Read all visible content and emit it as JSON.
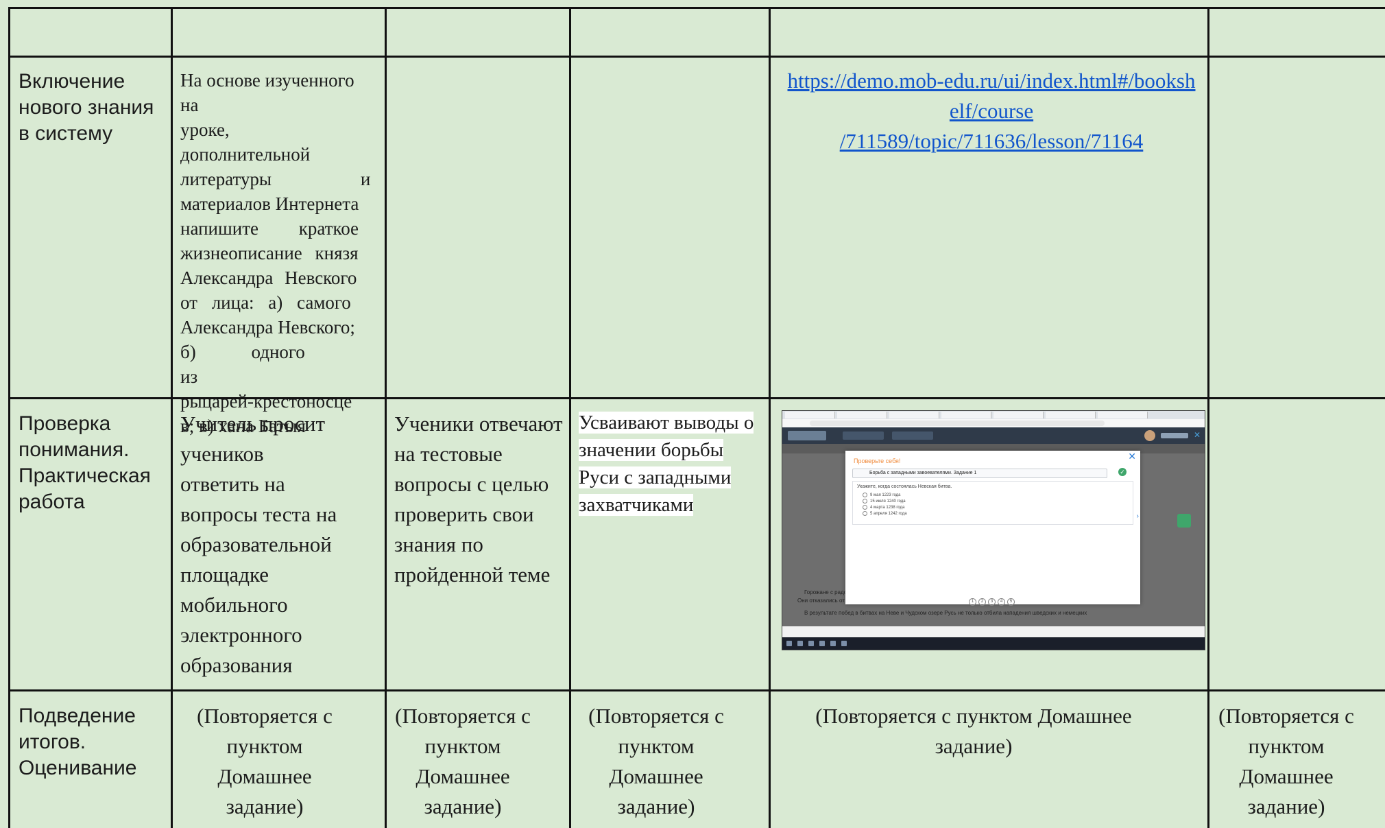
{
  "rows": {
    "inclusion": {
      "stage": "Включение нового знания в систему",
      "teacher_lines": [
        "На основе изученного",
        "на уроке,",
        "дополнительной",
        "литературы и",
        "материалов Интернета",
        "напишите краткое",
        "жизнеописание князя",
        "Александра Невского",
        "от лица: а) самого",
        "Александра Невского;",
        "б) одного из",
        "рыцарей-крестоносце",
        "в; в) хана Батыя"
      ],
      "link_lines": [
        "https://demo.mob-edu.ru/ui/index.html#/booksh",
        "elf/course",
        "/711589/topic/711636/lesson/71164"
      ]
    },
    "check": {
      "stage": "Проверка понимания. Практическая работа",
      "teacher": "Учитель просит учеников ответить на вопросы теста на образовательной площадке мобильного электронного образования",
      "students": "Ученики отвечают на тестовые вопросы с целью проверить свои знания по пройденной теме",
      "result_lines": [
        "Усваивают выводы о",
        "значении борьбы",
        "Руси с западными",
        "захватчиками"
      ]
    },
    "summary": {
      "stage": "Подведение итогов. Оценивание",
      "repeat_text": "(Повторяется с пунктом Домашнее задание)"
    }
  },
  "screenshot": {
    "dialog_title": "Проверьте себя!",
    "question_header": "Борьба с западными завоевателями. Задание 1",
    "question": "Укажите, когда состоялась Невская битва.",
    "options": [
      "9 мая 1223 года",
      "15 июля 1240 года",
      "4 марта 1238 года",
      "5 апреля 1242 года"
    ],
    "pages": [
      "1",
      "2",
      "3",
      "4",
      "5"
    ],
    "page_caption_1": "Горожане с радо",
    "page_caption_2": "Они отказались от",
    "page_caption_3": "В результате побед в битвах на Неве и Чудском озере Русь не только отбила нападения шведских и немецких"
  }
}
